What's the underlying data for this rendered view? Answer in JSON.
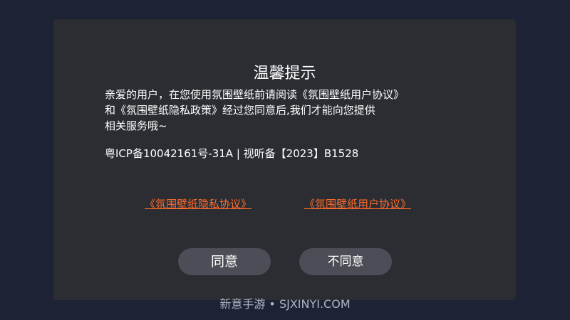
{
  "dialog": {
    "title": "温馨提示",
    "notice_lines": [
      "亲爱的用户，在您使用氛围壁纸前请阅读《氛围壁纸用户协议》",
      "和《氛围壁纸隐私政策》经过您同意后,我们才能向您提供",
      "相关服务哦~"
    ],
    "icp": "粤ICP备10042161号-31A | 视听备【2023】B1528",
    "links": {
      "privacy": "《氛围壁纸隐私协议》",
      "user": "《氛围壁纸用户协议》"
    },
    "buttons": {
      "agree": "同意",
      "disagree": "不同意"
    }
  },
  "watermark": "新意手游 • SJXINYI.COM",
  "colors": {
    "background": "#1e2235",
    "dialog": "#2b2d33",
    "link": "#ff6a2a",
    "button": "#4b4e56"
  }
}
